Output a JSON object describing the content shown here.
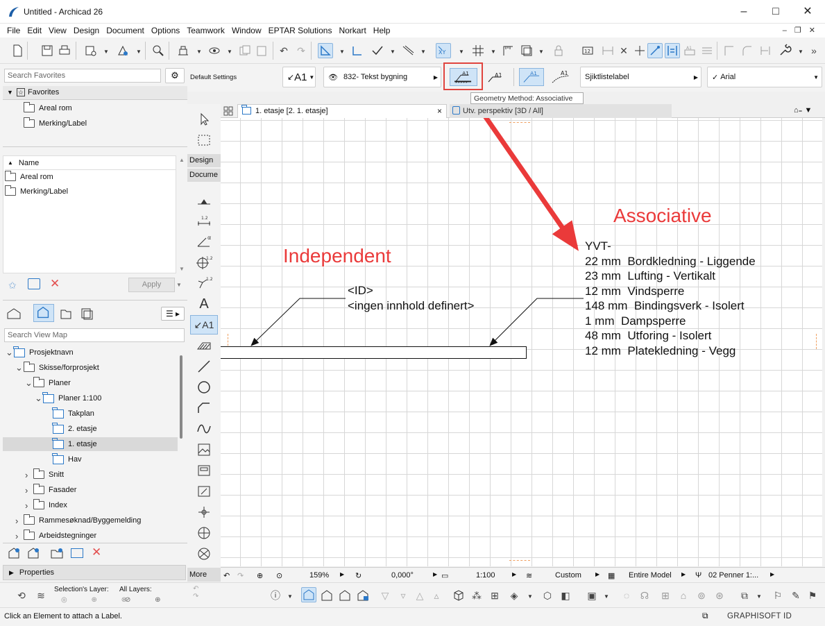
{
  "window": {
    "title": "Untitled - Archicad 26"
  },
  "menu": [
    "File",
    "Edit",
    "View",
    "Design",
    "Document",
    "Options",
    "Teamwork",
    "Window",
    "EPTAR Solutions",
    "Norkart",
    "Help"
  ],
  "left": {
    "search_favorites_placeholder": "Search Favorites",
    "favorites_header": "Favorites",
    "favorites": [
      "Areal rom",
      "Merking/Label"
    ],
    "name_header": "Name",
    "names": [
      "Areal rom",
      "Merking/Label"
    ],
    "apply_label": "Apply",
    "search_viewmap_placeholder": "Search View Map",
    "tree": [
      {
        "label": "Prosjektnavn",
        "level": 0,
        "type": "view",
        "open": true
      },
      {
        "label": "Skisse/forprosjekt",
        "level": 1,
        "type": "folder",
        "open": true
      },
      {
        "label": "Planer",
        "level": 2,
        "type": "folder",
        "open": true
      },
      {
        "label": "Planer 1:100",
        "level": 3,
        "type": "view",
        "open": true
      },
      {
        "label": "Takplan",
        "level": 4,
        "type": "view"
      },
      {
        "label": "2. etasje",
        "level": 4,
        "type": "view"
      },
      {
        "label": "1. etasje",
        "level": 4,
        "type": "view",
        "selected": true
      },
      {
        "label": "Hav",
        "level": 4,
        "type": "view"
      },
      {
        "label": "Snitt",
        "level": 2,
        "type": "folder",
        "open": false
      },
      {
        "label": "Fasader",
        "level": 2,
        "type": "folder",
        "open": false
      },
      {
        "label": "Index",
        "level": 2,
        "type": "folder",
        "open": false
      },
      {
        "label": "Rammesøknad/Byggemelding",
        "level": 1,
        "type": "folder",
        "open": false
      },
      {
        "label": "Arbeidstegninger",
        "level": 1,
        "type": "folder",
        "open": false
      }
    ],
    "properties_label": "Properties"
  },
  "infobox": {
    "default_settings": "Default Settings",
    "label_btn": "A1",
    "layer": "832- Tekst bygning",
    "tooltip": "Geometry Method: Associative",
    "a1": "A1",
    "label_type": "Sjiktlistelabel",
    "font": "Arial"
  },
  "toolbox": {
    "design": "Design",
    "document": "Docume",
    "more": "More",
    "label_tool": "A1",
    "dim_num_12": "1.2",
    "angle": "α",
    "text_tool": "A"
  },
  "tabs": {
    "tab1": "1. etasje [2. 1. etasje]",
    "tab2": "Utv. perspektiv [3D / All]",
    "close": "×"
  },
  "canvas": {
    "independent_title": "Independent",
    "associative_title": "Associative",
    "independent_label": [
      "<ID>",
      "<ingen innhold definert>"
    ],
    "associative_label": [
      "YVT-",
      "22 mm  Bordkledning - Liggende",
      "23 mm  Lufting - Vertikalt",
      "12 mm  Vindsperre",
      "148 mm  Bindingsverk - Isolert",
      "1 mm  Dampsperre",
      "48 mm  Utforing - Isolert",
      "12 mm  Platekledning - Vegg"
    ]
  },
  "statusnav": {
    "zoom": "159%",
    "angle": "0,000°",
    "scale": "1:100",
    "structure": "Custom",
    "model": "Entire Model",
    "pen": "02 Penner 1:..."
  },
  "bottombar": {
    "selections_layer": "Selection's Layer:",
    "all_layers": "All Layers:"
  },
  "status": {
    "message": "Click an Element to attach a Label.",
    "brand": "GRAPHISOFT ID"
  },
  "colors": {
    "accent": "#2b78c7",
    "annotation_red": "#ea3a3a",
    "highlight_box": "#e0443e"
  }
}
